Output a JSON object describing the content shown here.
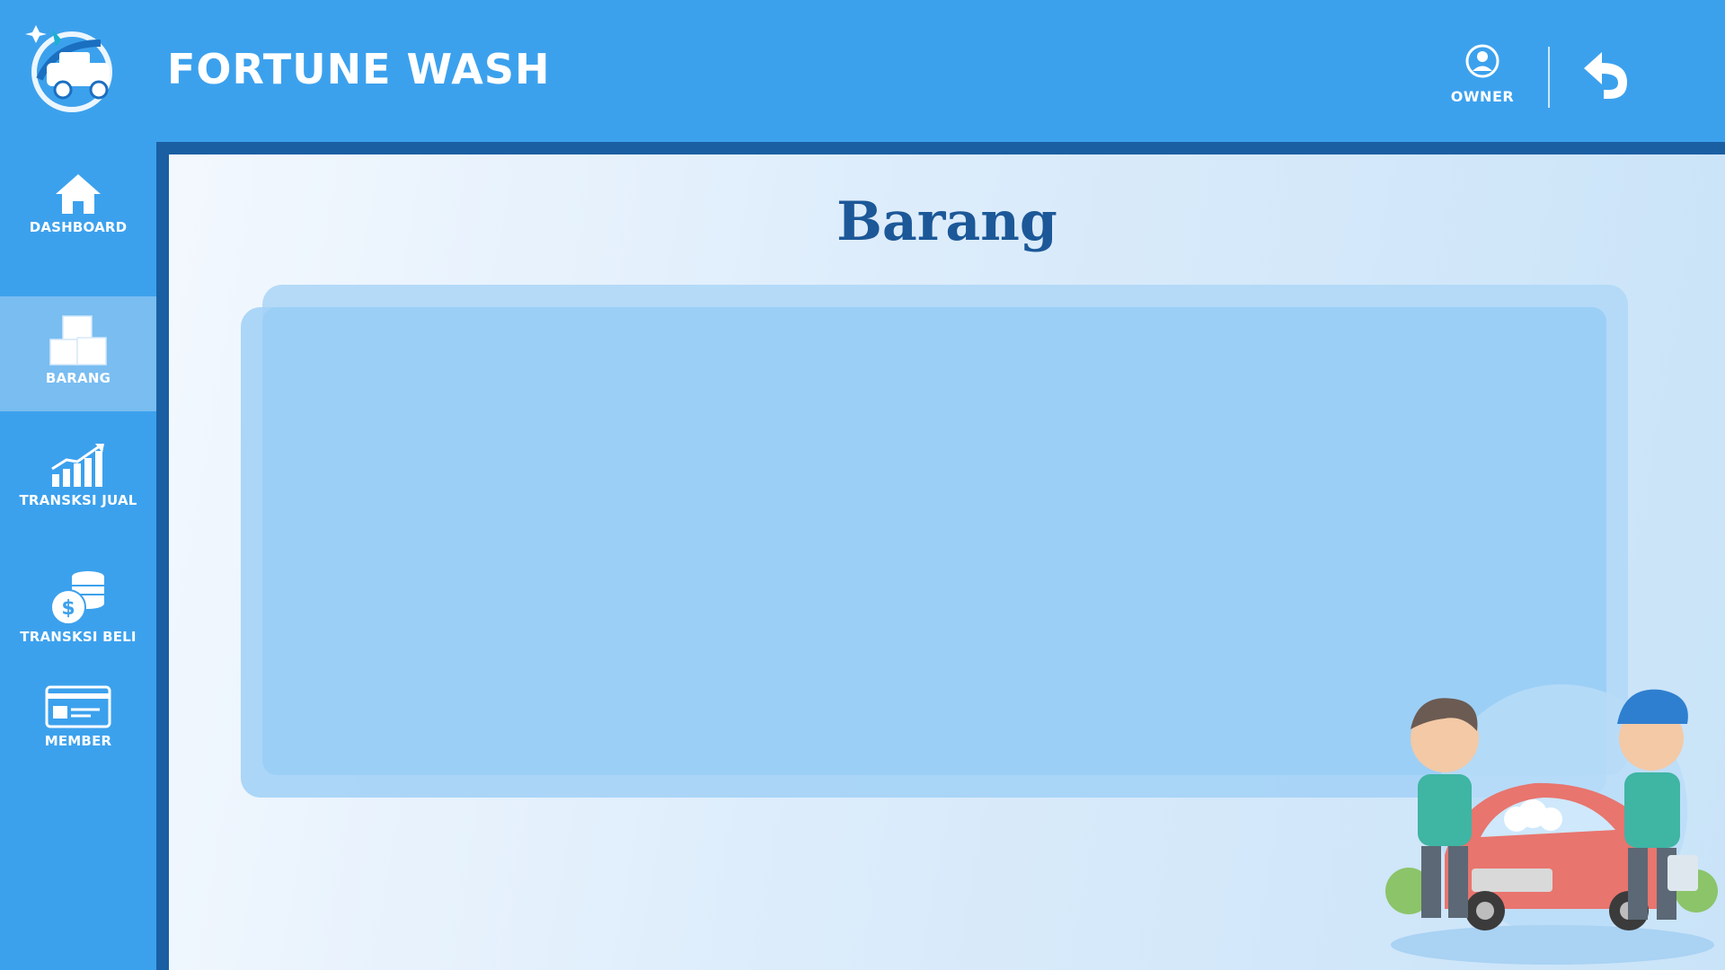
{
  "header": {
    "title": "FORTUNE WASH",
    "user_label": "OWNER"
  },
  "sidebar": {
    "items": [
      {
        "label": "DASHBOARD",
        "icon": "home-icon",
        "active": false
      },
      {
        "label": "BARANG",
        "icon": "boxes-icon",
        "active": true
      },
      {
        "label": "TRANSKSI JUAL",
        "icon": "chart-growth-icon",
        "active": false
      },
      {
        "label": "TRANSKSI BELI",
        "icon": "coins-icon",
        "active": false
      },
      {
        "label": "MEMBER",
        "icon": "member-card-icon",
        "active": false
      }
    ]
  },
  "main": {
    "page_title": "Barang"
  },
  "colors": {
    "header_bg": "#3ca1ed",
    "frame": "#1b5fa3",
    "title": "#1c5898",
    "active_nav": "#79bdf1",
    "panel": "#9ccff6"
  }
}
